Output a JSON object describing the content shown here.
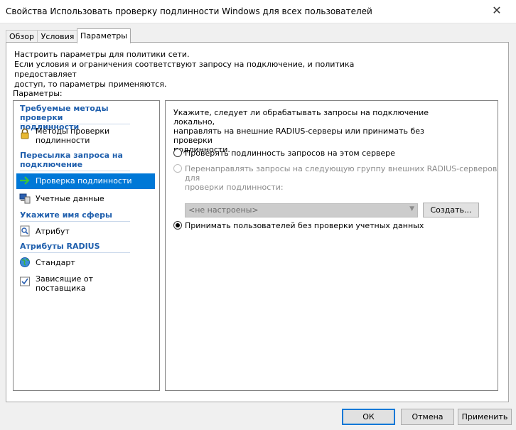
{
  "window": {
    "title": "Свойства Использовать проверку подлинности Windows для всех пользователей",
    "close_glyph": "✕"
  },
  "tabs": [
    {
      "label": "Обзор"
    },
    {
      "label": "Условия"
    },
    {
      "label": "Параметры"
    }
  ],
  "intro": {
    "line1": "Настроить параметры для политики сети.",
    "line2": "Если условия и ограничения соответствуют запросу на подключение, и политика предоставляет",
    "line3": "доступ, то параметры применяются."
  },
  "params_label": "Параметры:",
  "sidebar": {
    "sections": [
      {
        "title_line1": "Требуемые методы проверки",
        "title_line2": "подлинности"
      },
      {
        "title_line1": "Пересылка запроса на",
        "title_line2": "подключение"
      },
      {
        "title_line1": "Укажите имя сферы"
      },
      {
        "title_line1": "Атрибуты RADIUS"
      }
    ],
    "items": [
      {
        "line1": "Методы проверки",
        "line2": "подлинности",
        "icon": "lock-icon"
      },
      {
        "line1": "Проверка подлинности",
        "icon": "arrow-right-icon",
        "selected": true
      },
      {
        "line1": "Учетные данные",
        "icon": "computer-icon"
      },
      {
        "line1": "Атрибут",
        "icon": "magnifier-document-icon"
      },
      {
        "line1": "Стандарт",
        "icon": "globe-icon"
      },
      {
        "line1": "Зависящие от",
        "line2": "поставщика",
        "icon": "checkbox-document-icon"
      }
    ]
  },
  "content": {
    "description": {
      "line1": "Укажите, следует ли обрабатывать запросы на подключение локально,",
      "line2": "направлять на внешние RADIUS-серверы или принимать без проверки",
      "line3": "подлинности."
    },
    "options": [
      {
        "label": "Проверять подлинность запросов на этом сервере",
        "checked": false,
        "enabled": true
      },
      {
        "label_line1": "Перенаправлять запросы на следующую группу внешних RADIUS-серверов для",
        "label_line2": "проверки подлинности:",
        "checked": false,
        "enabled": false
      },
      {
        "label": "Принимать пользователей без проверки учетных данных",
        "checked": true,
        "enabled": true
      }
    ],
    "server_group_select": {
      "value": "<не настроены>",
      "enabled": false
    },
    "create_button": "Создать..."
  },
  "footer": {
    "ok": "ОК",
    "cancel": "Отмена",
    "apply": "Применить"
  },
  "colors": {
    "accent": "#0078d7",
    "section_title": "#1f5fad",
    "disabled_text": "#8c8c8c"
  }
}
